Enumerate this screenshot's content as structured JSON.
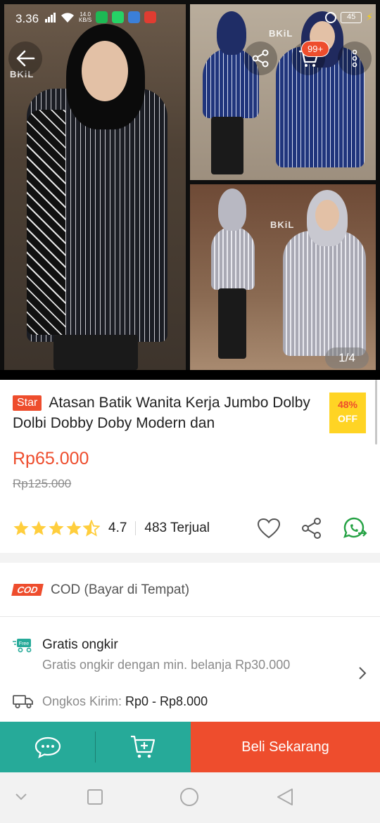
{
  "status_bar": {
    "time": "3.36",
    "net_speed_top": "14.0",
    "net_speed_unit": "KB/S",
    "battery": "45"
  },
  "gallery": {
    "pager": "1/4",
    "cart_badge": "99+",
    "brand_watermark": "BKiL"
  },
  "product": {
    "badge": "Star",
    "title": "Atasan Batik Wanita Kerja Jumbo Dolby Dolbi Dobby Doby Modern dan",
    "discount_pct": "48%",
    "discount_label": "OFF",
    "price": "Rp65.000",
    "original_price": "Rp125.000",
    "rating": "4.7",
    "rating_stars": 4.5,
    "sold": "483 Terjual"
  },
  "cod": {
    "badge": "COD",
    "label": "COD (Bayar di Tempat)"
  },
  "shipping": {
    "free_tag": "Free",
    "title": "Gratis ongkir",
    "subtitle": "Gratis ongkir dengan min. belanja Rp30.000",
    "cost_label": "Ongkos Kirim: ",
    "cost_value": "Rp0 - Rp8.000"
  },
  "bottom_bar": {
    "buy_label": "Beli Sekarang"
  },
  "colors": {
    "brand": "#ee4d2d",
    "teal": "#26aa99",
    "star": "#ffce3d",
    "discount_bg": "#ffd424"
  }
}
